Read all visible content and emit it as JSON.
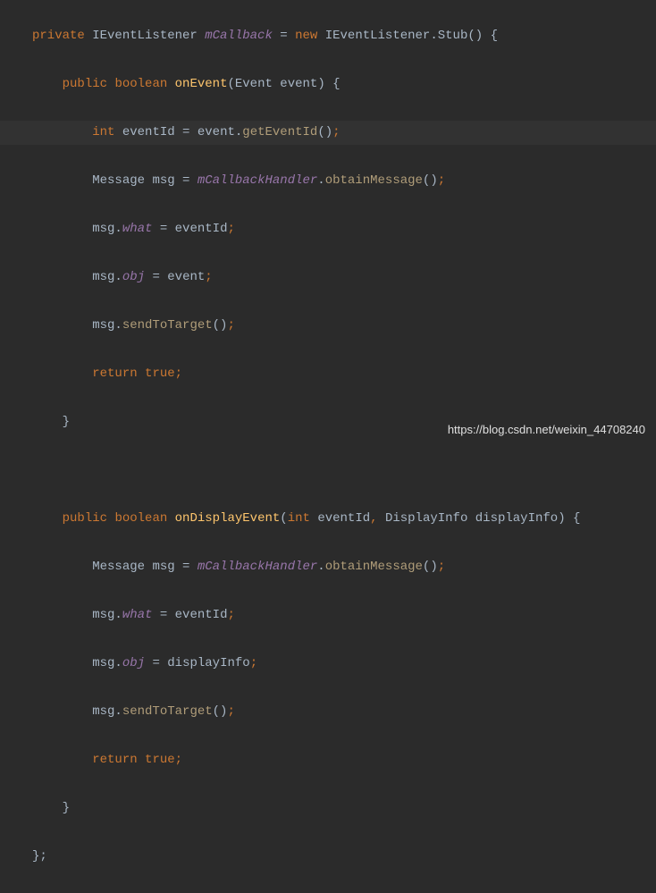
{
  "code": {
    "l1": {
      "kw_private": "private",
      "type_IEventListener": "IEventListener",
      "field_mCallback": "mCallback",
      "eq": " = ",
      "kw_new": "new",
      "type_IEventListenerStub": "IEventListener.Stub",
      "parens": "()",
      "brace": " {"
    },
    "l2": {
      "kw_public": "public",
      "kw_boolean": "boolean",
      "method": "onEvent",
      "sig_open": "(",
      "param_type": "Event",
      "param_name": "event",
      "sig_close": ")",
      "brace": " {"
    },
    "l3": {
      "kw_int": "int",
      "var": "eventId",
      "eq": " = ",
      "obj": "event.",
      "call": "getEventId",
      "parens": "()",
      "semi": ";"
    },
    "l4": {
      "type": "Message",
      "var": "msg",
      "eq": " = ",
      "ref": "mCallbackHandler",
      "dot": ".",
      "call": "obtainMessage",
      "parens": "()",
      "semi": ";"
    },
    "l5": {
      "obj": "msg.",
      "field": "what",
      "eq": " = ",
      "val": "eventId",
      "semi": ";"
    },
    "l6": {
      "obj": "msg.",
      "field": "obj",
      "eq": " = ",
      "val": "event",
      "semi": ";"
    },
    "l7": {
      "obj": "msg.",
      "call": "sendToTarget",
      "parens": "()",
      "semi": ";"
    },
    "l8": {
      "kw_return": "return",
      "kw_true": "true",
      "semi": ";"
    },
    "l9": {
      "brace": "}"
    },
    "l10": {
      "blank": ""
    },
    "l11": {
      "kw_public": "public",
      "kw_boolean": "boolean",
      "method": "onDisplayEvent",
      "sig_open": "(",
      "p1_type": "int",
      "p1_name": "eventId",
      "comma": ",",
      "p2_type": "DisplayInfo",
      "p2_name": "displayInfo",
      "sig_close": ")",
      "brace": " {"
    },
    "l12": {
      "type": "Message",
      "var": "msg",
      "eq": " = ",
      "ref": "mCallbackHandler",
      "dot": ".",
      "call": "obtainMessage",
      "parens": "()",
      "semi": ";"
    },
    "l13": {
      "obj": "msg.",
      "field": "what",
      "eq": " = ",
      "val": "eventId",
      "semi": ";"
    },
    "l14": {
      "obj": "msg.",
      "field": "obj",
      "eq": " = ",
      "val": "displayInfo",
      "semi": ";"
    },
    "l15": {
      "obj": "msg.",
      "call": "sendToTarget",
      "parens": "()",
      "semi": ";"
    },
    "l16": {
      "kw_return": "return",
      "kw_true": "true",
      "semi": ";"
    },
    "l17": {
      "brace": "}"
    },
    "l18": {
      "brace": "};"
    }
  },
  "watermark": "https://blog.csdn.net/weixin_44708240"
}
